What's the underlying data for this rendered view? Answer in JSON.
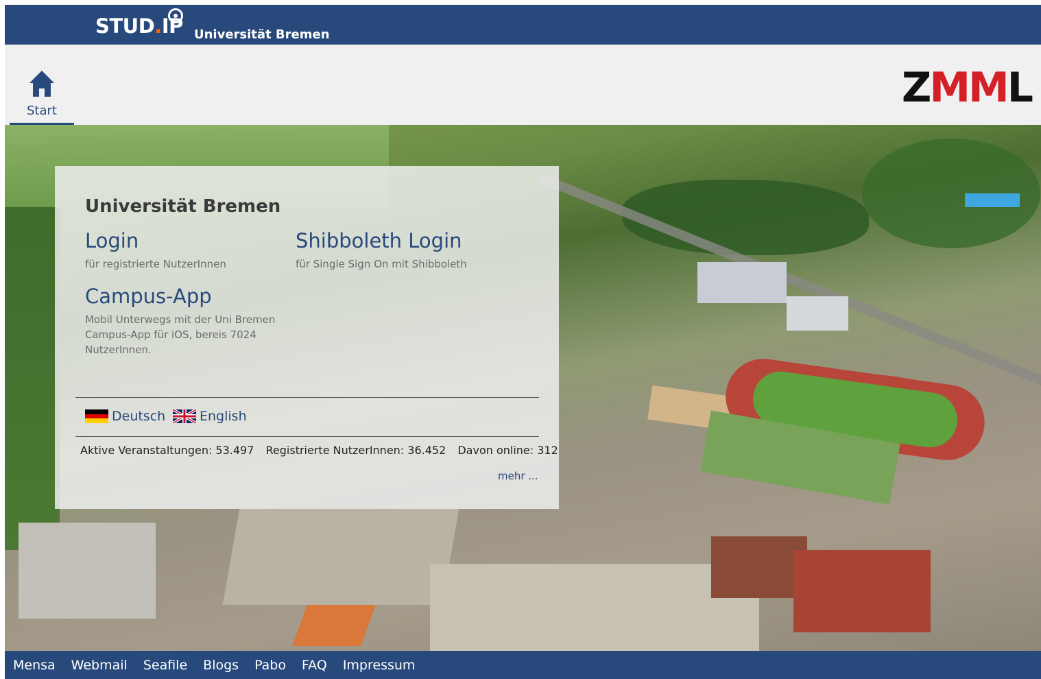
{
  "header": {
    "brand_prefix": "STUD",
    "brand_dot": ".",
    "brand_suffix": "IP",
    "university": "Universität Bremen"
  },
  "nav": {
    "start_label": "Start",
    "partner_logo": "ZMML"
  },
  "login_panel": {
    "title": "Universität Bremen",
    "login_label": "Login",
    "login_desc": "für registrierte NutzerInnen",
    "shibboleth_label": "Shibboleth Login",
    "shibboleth_desc": "für Single Sign On mit Shibboleth",
    "campus_app_label": "Campus-App",
    "campus_app_desc": "Mobil Unterwegs mit der Uni Bremen Campus-App für iOS, bereis 7024 NutzerInnen.",
    "languages": [
      {
        "label": "Deutsch",
        "icon": "flag-de-icon"
      },
      {
        "label": "English",
        "icon": "flag-uk-icon"
      }
    ],
    "stats": {
      "active_courses": "Aktive Veranstaltungen: 53.497",
      "registered_users": "Registrierte NutzerInnen: 36.452",
      "online": "Davon online: 312"
    },
    "more_link": "mehr ..."
  },
  "footer": {
    "links": [
      "Mensa",
      "Webmail",
      "Seafile",
      "Blogs",
      "Pabo",
      "FAQ",
      "Impressum"
    ]
  },
  "colors": {
    "brand_blue": "#28497c",
    "zmml_red": "#d31f26"
  }
}
